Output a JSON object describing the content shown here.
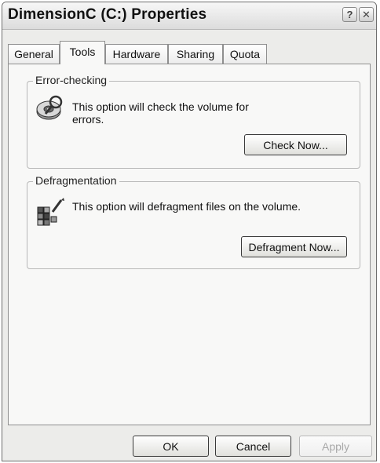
{
  "window": {
    "title": "DimensionC (C:) Properties",
    "help_button": "?",
    "close_button": "✕"
  },
  "tabs": [
    {
      "label": "General",
      "active": false
    },
    {
      "label": "Tools",
      "active": true
    },
    {
      "label": "Hardware",
      "active": false
    },
    {
      "label": "Sharing",
      "active": false
    },
    {
      "label": "Quota",
      "active": false
    }
  ],
  "error_checking": {
    "heading": "Error-checking",
    "description_line1": "This option will check the volume for",
    "description_line2": "errors.",
    "icon": "disk-check-icon",
    "button_label": "Check Now..."
  },
  "defragmentation": {
    "heading": "Defragmentation",
    "description": "This option will defragment files on the volume.",
    "icon": "defragment-icon",
    "button_label": "Defragment Now..."
  },
  "footer": {
    "ok_label": "OK",
    "cancel_label": "Cancel",
    "apply_label": "Apply"
  }
}
